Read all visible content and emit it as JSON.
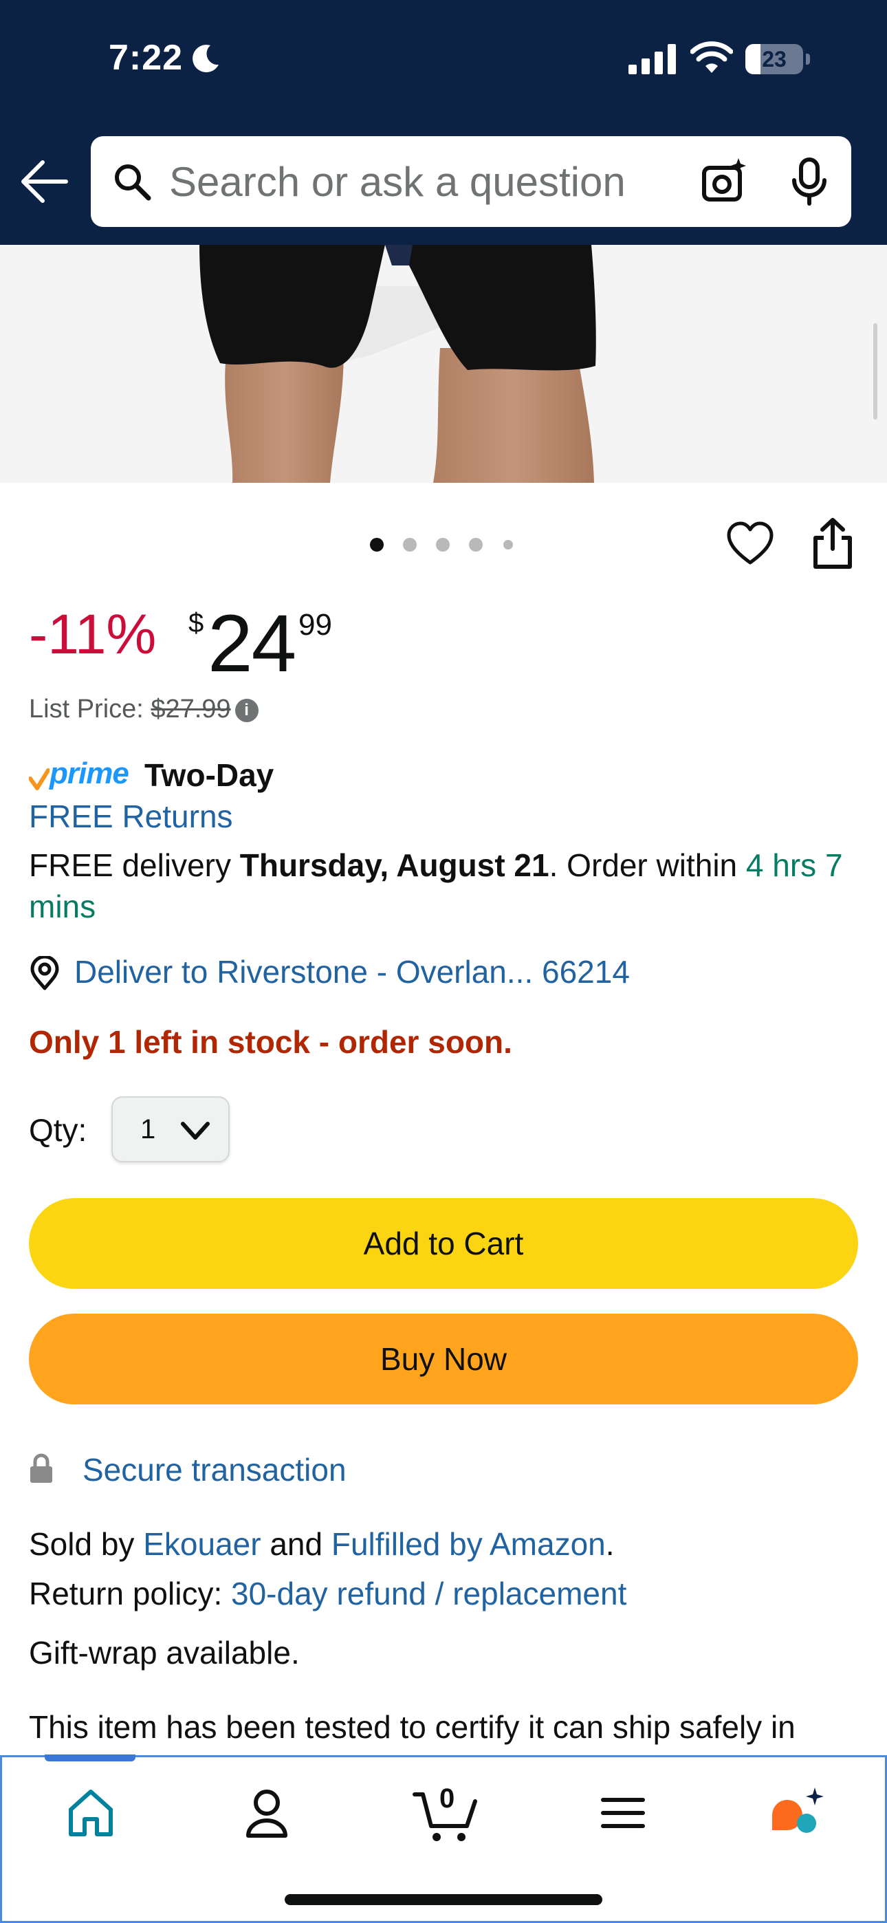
{
  "status_bar": {
    "time": "7:22",
    "battery": "23"
  },
  "search": {
    "placeholder": "Search or ask a question"
  },
  "carousel": {
    "dot_count": 5,
    "active_index": 0
  },
  "price": {
    "discount": "-11%",
    "currency": "$",
    "whole": "24",
    "fraction": "99",
    "list_price_label": "List Price: ",
    "list_price": "$27.99"
  },
  "delivery": {
    "prime_label": "prime",
    "prime_speed": "Two-Day",
    "free_returns": "FREE Returns",
    "prefix": "FREE delivery ",
    "date": "Thursday, August 21",
    "order_within": ". Order within ",
    "countdown": "4 hrs 7 mins",
    "deliver_to": "Deliver to Riverstone - Overlan... 66214"
  },
  "stock": {
    "message": "Only 1 left in stock - order soon."
  },
  "quantity": {
    "label": "Qty:",
    "value": "1"
  },
  "buttons": {
    "add_to_cart": "Add to Cart",
    "buy_now": "Buy Now"
  },
  "seller": {
    "secure": "Secure transaction",
    "sold_by_prefix": "Sold by ",
    "seller_name": "Ekouaer",
    "and": " and ",
    "fulfilled": "Fulfilled by Amazon",
    "period": ".",
    "return_label": "Return policy: ",
    "return_link": "30-day refund / replacement",
    "gift_wrap": "Gift-wrap available.",
    "tested": "This item has been tested to certify it can ship safely in"
  },
  "bottom_nav": {
    "cart_count": "0"
  },
  "colors": {
    "header_bg": "#0c2245",
    "add_to_cart": "#fcd512",
    "buy_now": "#ffa41c",
    "discount": "#cc0c39",
    "link": "#2162a1",
    "stock_warning": "#b12704",
    "countdown_green": "#067d62",
    "prime_blue": "#1a98ff"
  }
}
